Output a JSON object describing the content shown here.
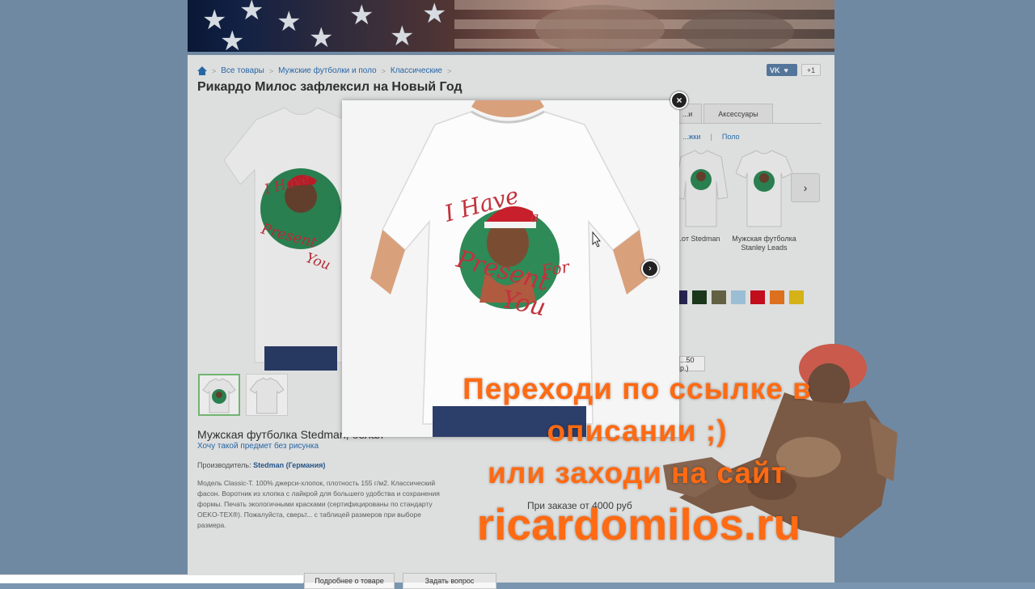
{
  "breadcrumb": {
    "items": [
      "Все товары",
      "Мужские футболки и поло",
      "Классические"
    ]
  },
  "page_title": "Рикардо Милос зафлексил на Новый Год",
  "social": {
    "vk_label": "VK",
    "gplus_label": "+1"
  },
  "tabs": [
    {
      "label": "...и"
    },
    {
      "label": "Аксессуары"
    }
  ],
  "subtabs": [
    "...жки",
    "Поло"
  ],
  "related": [
    {
      "label": "...от Stedman"
    },
    {
      "label": "Мужская футболка Stanley Leads"
    }
  ],
  "product": {
    "name": "Мужская футболка Stedman, белая",
    "want_link": "Хочу такой предмет без рисунка",
    "maker_label": "Производитель:",
    "maker_value": "Stedman (Германия)",
    "description": "Модель Classic-T. 100% джерси-хлопок, плотность 155 г/м2. Классический фасон. Воротник из хлопка с лайкрой для большего удобства и сохранения формы. Печать экологичными красками (сертифицированы по стандарту OEKO-TEX®). Пожалуйста, сверьт... с таблицей размеров при выборе размера."
  },
  "price_fragment": "...50 р.)",
  "bulk_note": "При заказе от 4000 руб",
  "bottom_buttons": [
    "Подробнее о товаре",
    "Задать вопрос"
  ],
  "swatch_colors": [
    "#2b2a5a",
    "#1d3b1e",
    "#6b6a4a",
    "#a9cfe6",
    "#d20f1f",
    "#ef7a21",
    "#e8c21a"
  ],
  "design": {
    "line1": "I Have",
    "line1b": "a",
    "line2": "Present",
    "line2b": "For",
    "line3": "You",
    "circle_color": "#2e8a57",
    "text_color": "#c2323c"
  },
  "overlay": {
    "line1": "Переходи по ссылке в",
    "line2": "описании ;)",
    "line3": "или заходи на сайт",
    "site": "ricardomilos.ru",
    "color": "#ff6a12"
  }
}
